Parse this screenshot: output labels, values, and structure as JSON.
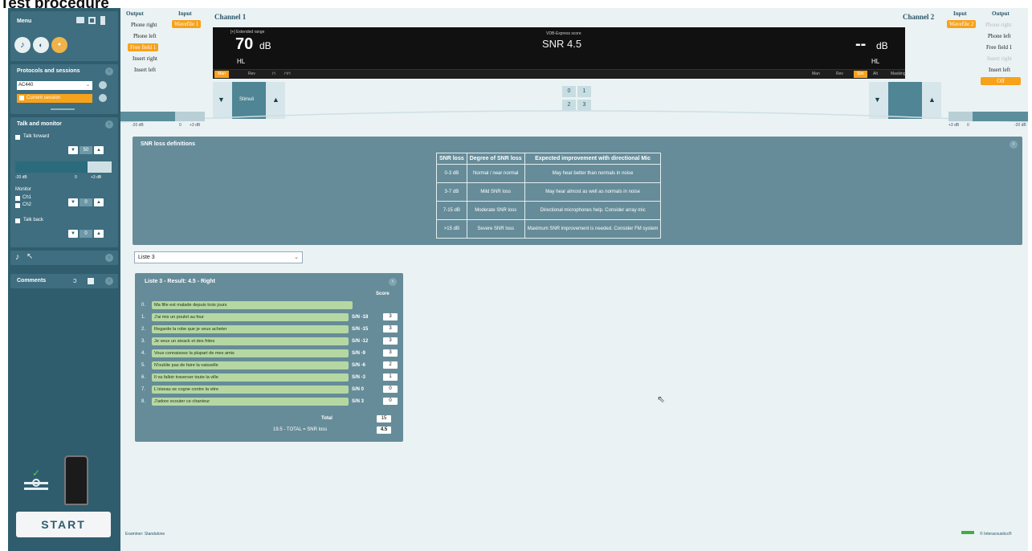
{
  "page_heading": "Test procedure",
  "sidebar": {
    "menu_label": "Menu",
    "protocols_title": "Protocols and sessions",
    "protocol_value": "AC440",
    "current_session": "Current session",
    "talk_monitor_title": "Talk and monitor",
    "talk_forward": "Talk forward",
    "talk_forward_value": "50",
    "slider_min": "-20 dB",
    "slider_zero": "0",
    "slider_max": "+3 dB",
    "monitor_label": "Monitor",
    "ch1": "Ch1",
    "ch2": "Ch2",
    "monitor_value": "0",
    "talk_back": "Talk back",
    "talk_back_value": "0",
    "comments_title": "Comments",
    "start_label": "START"
  },
  "channel1": {
    "title": "Channel 1",
    "output_head": "Output",
    "input_head": "Input",
    "outputs": [
      "Phone right",
      "Phone left",
      "Free field 1",
      "Insert right",
      "Insert left"
    ],
    "active_output_index": 2,
    "input_value": "Wavefile 1",
    "stim_label": "Stimuli",
    "slider_min": "-20 dB",
    "slider_zero": "0",
    "slider_max": "+3 dB"
  },
  "channel2": {
    "title": "Channel 2",
    "output_head": "Output",
    "input_head": "Input",
    "input_value": "Wavefile 2",
    "outputs": [
      "Phone right",
      "Phone left",
      "Free field 1",
      "Insert right",
      "Insert left"
    ],
    "dim_outputs": [
      0,
      3
    ],
    "off_label": "Off",
    "slider_max": "+3 dB",
    "slider_zero": "0",
    "slider_min": "-20 dB"
  },
  "display": {
    "extended_range": "[+] Extended range",
    "level": "70",
    "unit": "dB",
    "hl": "HL",
    "score_title": "VDB-Express score",
    "snr_text": "SNR 4.5",
    "right_level": "--",
    "right_unit": "dB",
    "right_hl": "HL",
    "bar_left": [
      "Man",
      "Rev"
    ],
    "bar_right": [
      "Man",
      "Rev",
      "Sim",
      "Alt",
      "Masking"
    ]
  },
  "grid_buttons": [
    "0",
    "1",
    "2",
    "3"
  ],
  "snr_panel": {
    "title": "SNR loss definitions",
    "headers": [
      "SNR loss",
      "Degree of SNR loss",
      "Expected improvement with directional Mic"
    ],
    "rows": [
      [
        "0-3 dB",
        "Normal / near normal",
        "May hear better than normals in noise"
      ],
      [
        "3-7 dB",
        "Mild SNR loss",
        "May hear almost as well as normals in noise"
      ],
      [
        "7-15 dB",
        "Moderate SNR loss",
        "Directional microphones help. Consider array mic"
      ],
      [
        ">15 dB",
        "Severe SNR loss",
        "Maximum SNR improvement is needed. Consider FM system"
      ]
    ]
  },
  "list_select": "Liste 3",
  "result_panel": {
    "title": "Liste 3 - Result: 4.5 - Right",
    "score_head": "Score",
    "rows": [
      {
        "num": "0.",
        "text": "Ma fille est malade depuis trois jours",
        "sn": "",
        "score": ""
      },
      {
        "num": "1.",
        "text": "J'ai mis un poulet au four",
        "sn": "S/N -18",
        "score": "3"
      },
      {
        "num": "2.",
        "text": "Regarde la robe que je veux acheter",
        "sn": "S/N -15",
        "score": "3"
      },
      {
        "num": "3.",
        "text": "Je veux un steack et des frites",
        "sn": "S/N -12",
        "score": "3"
      },
      {
        "num": "4.",
        "text": "Vous connaissez la plupart de mes amis",
        "sn": "S/N -9",
        "score": "3"
      },
      {
        "num": "5.",
        "text": "N'oublie pas de faire la vaisselle",
        "sn": "S/N -6",
        "score": "2"
      },
      {
        "num": "6.",
        "text": "Il va falloir traverser toute la ville",
        "sn": "S/N -3",
        "score": "1"
      },
      {
        "num": "7.",
        "text": "L'oiseau se cogne contre la vitre",
        "sn": "S/N 0",
        "score": "0"
      },
      {
        "num": "8.",
        "text": "J'adore ecouter ce chanteur",
        "sn": "S/N 3",
        "score": "0"
      }
    ],
    "total_label": "Total",
    "total_value": "15",
    "formula_label": "19.5 - TOTAL = SNR loss",
    "snr_loss_value": "4.5"
  },
  "footer": {
    "examiner": "Examiner: Standalone",
    "copyright": "© Interacoustics®"
  },
  "colors": {
    "accent": "#f7a21b",
    "sidebar": "#2f5d6e",
    "panel": "#668c99",
    "word_bar": "#b5d8a3"
  }
}
